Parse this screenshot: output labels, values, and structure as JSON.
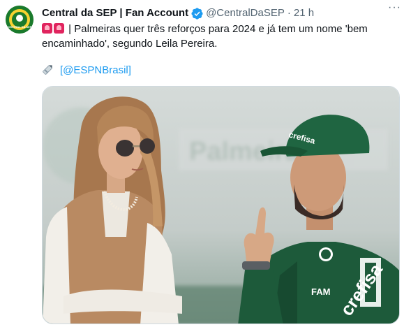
{
  "tweet": {
    "display_name": "Central da SEP | Fan Account",
    "handle": "@CentralDaSEP",
    "separator": "·",
    "time": "21 h",
    "text": "| Palmeiras quer três reforços para 2024 e já tem um nome 'bem encaminhado', segundo Leila Pereira.",
    "source_link": "@ESPNBrasil",
    "source_open": "[",
    "source_close": "]",
    "more_label": "···"
  },
  "avatar": {
    "text": "CENTRAL DA SEP"
  },
  "photo": {
    "shirt_sponsor": "crefisa",
    "cap_sponsor": "crefisa",
    "chest_sponsor": "FAM",
    "blur_text": "Palmeiras"
  },
  "icons": {
    "verified": "verified-badge-icon",
    "more": "more-dots-icon",
    "siren": "siren-emoji-icon",
    "pen": "pen-emoji-icon"
  },
  "colors": {
    "text": "#0f1419",
    "secondary": "#536471",
    "link": "#1d9bf0",
    "verified": "#1d9bf0",
    "palmeiras_green": "#1d5a3a"
  }
}
